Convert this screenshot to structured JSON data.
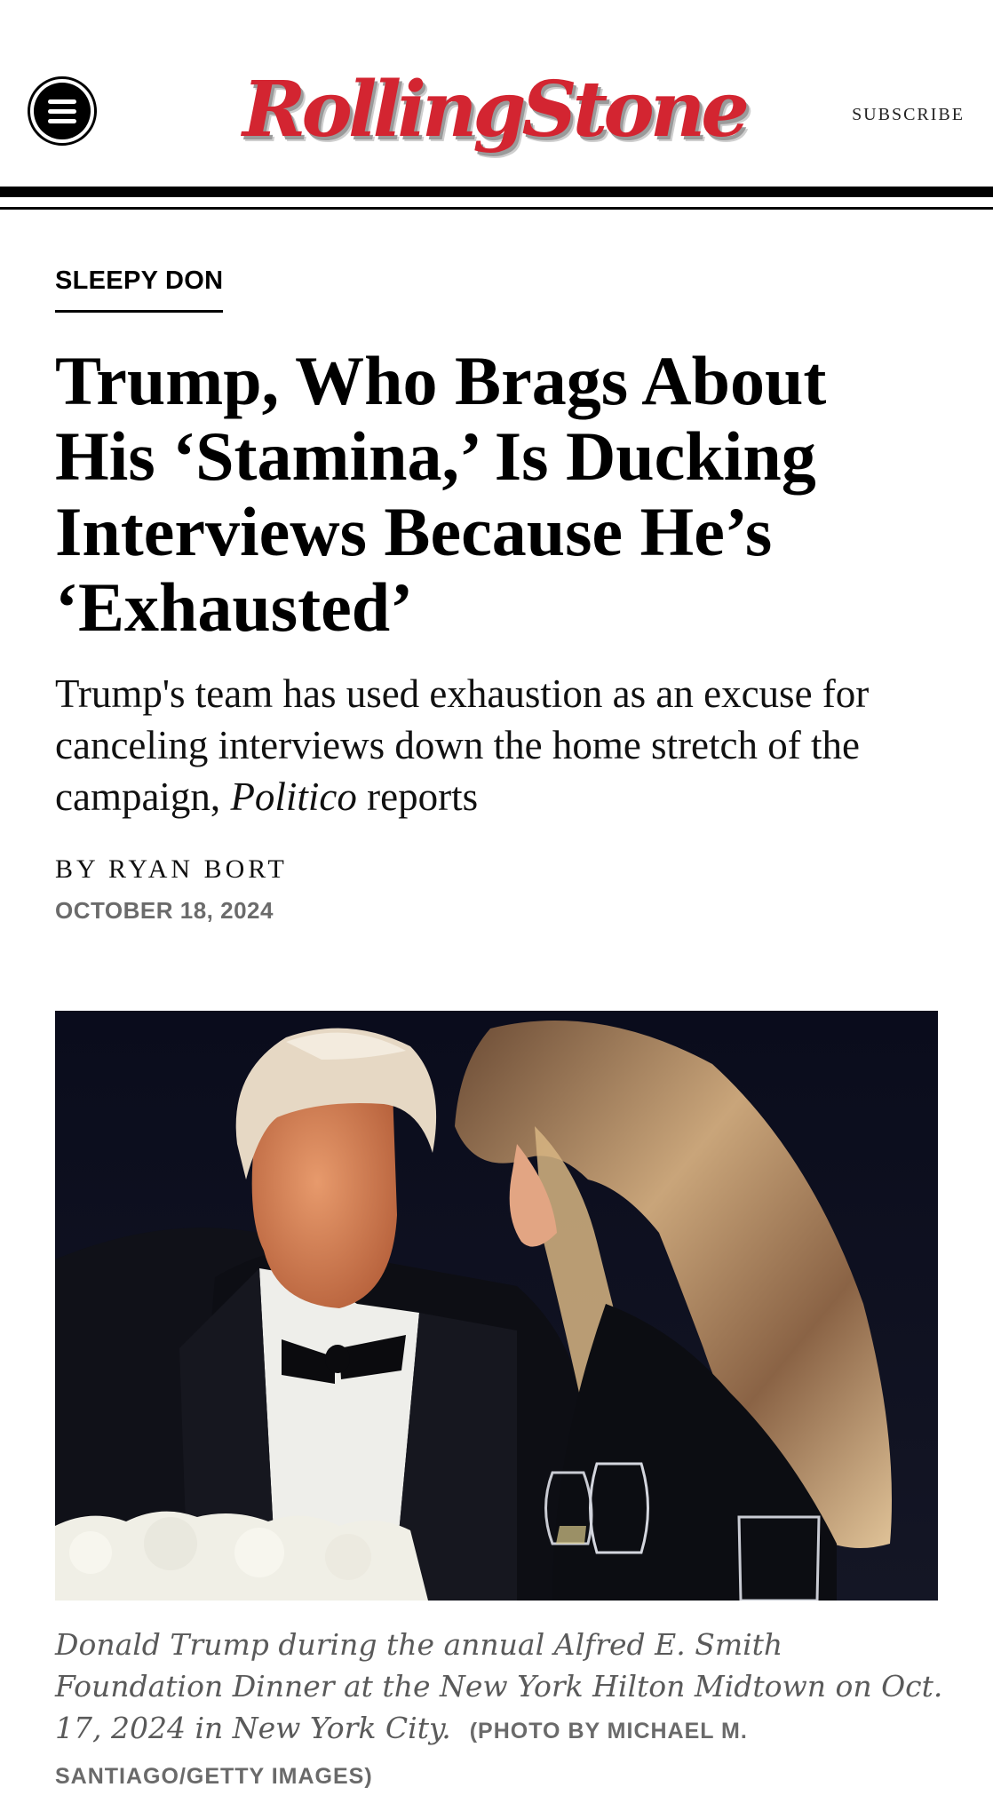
{
  "header": {
    "logo_text": "RollingStone",
    "subscribe_label": "SUBSCRIBE",
    "menu_icon": "hamburger-menu-icon",
    "brand_color": "#d32531"
  },
  "article": {
    "kicker": "SLEEPY DON",
    "headline": "Trump, Who Brags About His ‘Stamina,’ Is Ducking Interviews Because He’s ‘Exhausted’",
    "dek_part1": "Trump's team has used exhaustion as an excuse for canceling interviews down the home stretch of the campaign, ",
    "dek_italic": "Politico",
    "dek_part2": " reports",
    "byline": "BY RYAN BORT",
    "date": "OCTOBER 18, 2024"
  },
  "photo": {
    "caption": "Donald Trump during the annual Alfred E. Smith Foundation Dinner at the New York Hilton Midtown on Oct. 17, 2024 in New York City.",
    "credit": "(PHOTO BY MICHAEL M. SANTIAGO/GETTY IMAGES)"
  }
}
